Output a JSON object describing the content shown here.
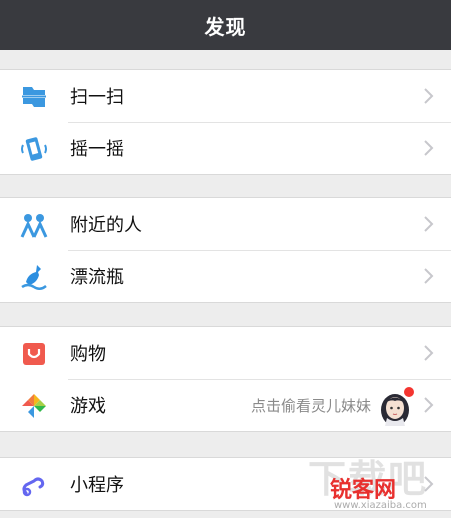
{
  "header": {
    "title": "发现"
  },
  "groups": [
    {
      "items": [
        {
          "label": "扫一扫"
        },
        {
          "label": "摇一摇"
        }
      ]
    },
    {
      "items": [
        {
          "label": "附近的人"
        },
        {
          "label": "漂流瓶"
        }
      ]
    },
    {
      "items": [
        {
          "label": "购物"
        },
        {
          "label": "游戏",
          "sub": "点击偷看灵儿妹妹"
        }
      ]
    },
    {
      "items": [
        {
          "label": "小程序"
        }
      ]
    }
  ],
  "watermark": {
    "title": "锐客网",
    "logo": "下载吧",
    "url": "www.xiazaiba.com"
  },
  "icons": {
    "scan": "scan-icon",
    "shake": "shake-icon",
    "nearby": "people-nearby-icon",
    "bottle": "drift-bottle-icon",
    "shop": "shopping-bag-icon",
    "games": "games-icon",
    "mini": "mini-program-icon",
    "chevron": "chevron-right-icon"
  },
  "colors": {
    "header_bg": "#393a3f",
    "accent_blue": "#3b98e0",
    "shop_red": "#f05a4e",
    "badge_red": "#f43530"
  }
}
